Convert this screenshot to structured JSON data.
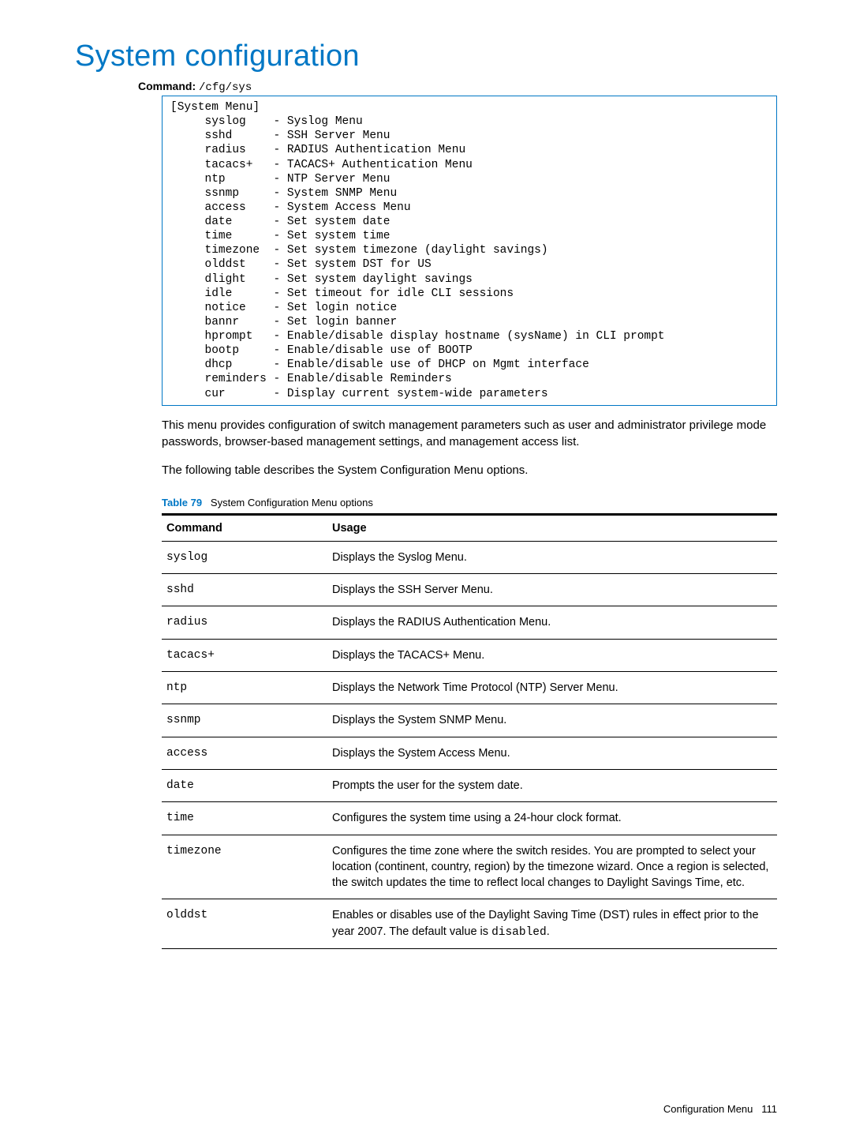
{
  "title": "System configuration",
  "command_label": "Command:",
  "command_path": "/cfg/sys",
  "code": "[System Menu]\n     syslog    - Syslog Menu\n     sshd      - SSH Server Menu\n     radius    - RADIUS Authentication Menu\n     tacacs+   - TACACS+ Authentication Menu\n     ntp       - NTP Server Menu\n     ssnmp     - System SNMP Menu\n     access    - System Access Menu\n     date      - Set system date\n     time      - Set system time\n     timezone  - Set system timezone (daylight savings)\n     olddst    - Set system DST for US\n     dlight    - Set system daylight savings\n     idle      - Set timeout for idle CLI sessions\n     notice    - Set login notice\n     bannr     - Set login banner\n     hprompt   - Enable/disable display hostname (sysName) in CLI prompt\n     bootp     - Enable/disable use of BOOTP\n     dhcp      - Enable/disable use of DHCP on Mgmt interface\n     reminders - Enable/disable Reminders\n     cur       - Display current system-wide parameters",
  "para1": "This menu provides configuration of switch management parameters such as user and administrator privilege mode passwords, browser-based management settings, and management access list.",
  "para2": "The following table describes the System Configuration Menu options.",
  "table_caption_num": "Table 79",
  "table_caption_text": "System Configuration Menu options",
  "table_head": {
    "col1": "Command",
    "col2": "Usage"
  },
  "rows": [
    {
      "cmd": "syslog",
      "usage": "Displays the Syslog Menu."
    },
    {
      "cmd": "sshd",
      "usage": "Displays the SSH Server Menu."
    },
    {
      "cmd": "radius",
      "usage": "Displays the RADIUS Authentication Menu."
    },
    {
      "cmd": "tacacs+",
      "usage": "Displays the TACACS+ Menu."
    },
    {
      "cmd": "ntp",
      "usage": "Displays the Network Time Protocol (NTP) Server Menu."
    },
    {
      "cmd": "ssnmp",
      "usage": "Displays the System SNMP Menu."
    },
    {
      "cmd": "access",
      "usage": "Displays the System Access Menu."
    },
    {
      "cmd": "date",
      "usage": "Prompts the user for the system date."
    },
    {
      "cmd": "time",
      "usage": "Configures the system time using a 24-hour clock format."
    },
    {
      "cmd": "timezone",
      "usage": "Configures the time zone where the switch resides. You are prompted to select your location (continent, country, region) by the timezone wizard. Once a region is selected, the switch updates the time to reflect local changes to Daylight Savings Time, etc."
    }
  ],
  "olddst": {
    "cmd": "olddst",
    "usage_pre": "Enables or disables use of the Daylight Saving Time (DST) rules in effect prior to the year 2007. The default value is ",
    "code": "disabled",
    "usage_post": "."
  },
  "footer": {
    "section": "Configuration Menu",
    "page": "111"
  }
}
